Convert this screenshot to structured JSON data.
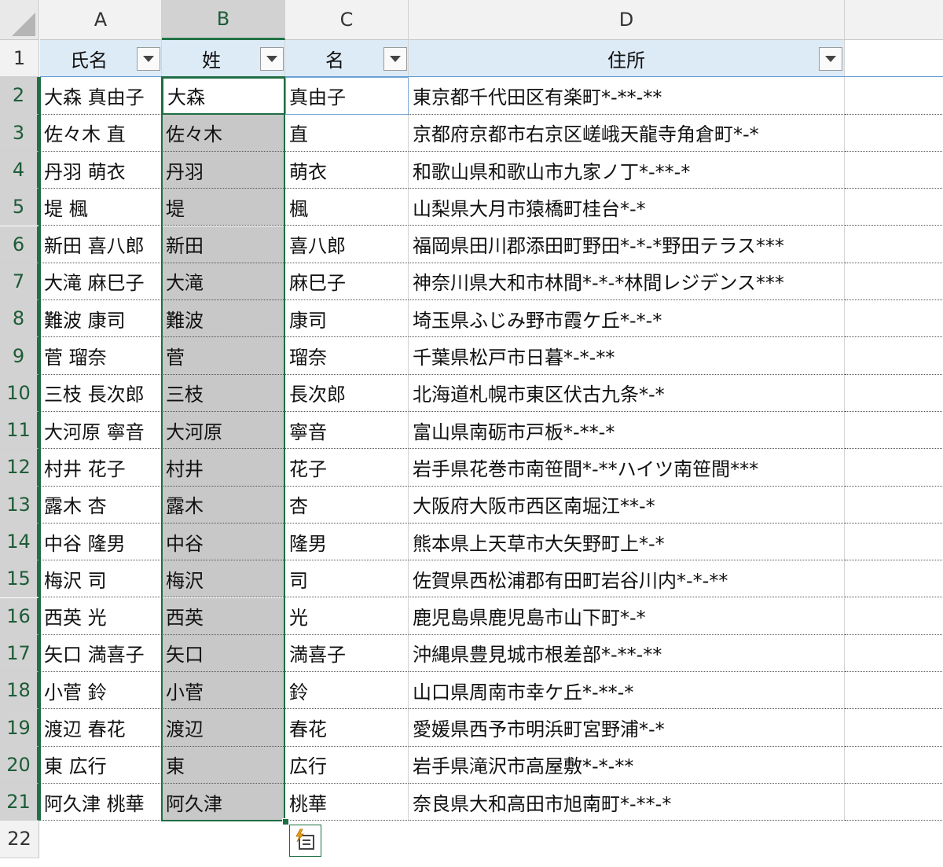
{
  "columns": [
    {
      "letter": "A",
      "selected": false
    },
    {
      "letter": "B",
      "selected": true
    },
    {
      "letter": "C",
      "selected": false
    },
    {
      "letter": "D",
      "selected": false
    }
  ],
  "header_row": {
    "row": "1",
    "cells": [
      "氏名",
      "姓",
      "名",
      "住所"
    ]
  },
  "rows": [
    {
      "row": "2",
      "cells": [
        "大森 真由子",
        "大森",
        "真由子",
        "東京都千代田区有楽町*-**-**"
      ]
    },
    {
      "row": "3",
      "cells": [
        "佐々木 直",
        "佐々木",
        "直",
        "京都府京都市右京区嵯峨天龍寺角倉町*-*"
      ]
    },
    {
      "row": "4",
      "cells": [
        "丹羽 萌衣",
        "丹羽",
        "萌衣",
        "和歌山県和歌山市九家ノ丁*-**-*"
      ]
    },
    {
      "row": "5",
      "cells": [
        "堤 楓",
        "堤",
        "楓",
        "山梨県大月市猿橋町桂台*-*"
      ]
    },
    {
      "row": "6",
      "cells": [
        "新田 喜八郎",
        "新田",
        "喜八郎",
        "福岡県田川郡添田町野田*-*-*野田テラス***"
      ]
    },
    {
      "row": "7",
      "cells": [
        "大滝 麻巳子",
        "大滝",
        "麻巳子",
        "神奈川県大和市林間*-*-*林間レジデンス***"
      ]
    },
    {
      "row": "8",
      "cells": [
        "難波 康司",
        "難波",
        "康司",
        "埼玉県ふじみ野市霞ケ丘*-*-*"
      ]
    },
    {
      "row": "9",
      "cells": [
        "菅 瑠奈",
        "菅",
        "瑠奈",
        "千葉県松戸市日暮*-*-**"
      ]
    },
    {
      "row": "10",
      "cells": [
        "三枝 長次郎",
        "三枝",
        "長次郎",
        "北海道札幌市東区伏古九条*-*"
      ]
    },
    {
      "row": "11",
      "cells": [
        "大河原 寧音",
        "大河原",
        "寧音",
        "富山県南砺市戸板*-**-*"
      ]
    },
    {
      "row": "12",
      "cells": [
        "村井 花子",
        "村井",
        "花子",
        "岩手県花巻市南笹間*-**ハイツ南笹間***"
      ]
    },
    {
      "row": "13",
      "cells": [
        "露木 杏",
        "露木",
        "杏",
        "大阪府大阪市西区南堀江**-*"
      ]
    },
    {
      "row": "14",
      "cells": [
        "中谷 隆男",
        "中谷",
        "隆男",
        "熊本県上天草市大矢野町上*-*"
      ]
    },
    {
      "row": "15",
      "cells": [
        "梅沢 司",
        "梅沢",
        "司",
        "佐賀県西松浦郡有田町岩谷川内*-*-**"
      ]
    },
    {
      "row": "16",
      "cells": [
        "西英 光",
        "西英",
        "光",
        "鹿児島県鹿児島市山下町*-*"
      ]
    },
    {
      "row": "17",
      "cells": [
        "矢口 満喜子",
        "矢口",
        "満喜子",
        "沖縄県豊見城市根差部*-**-**"
      ]
    },
    {
      "row": "18",
      "cells": [
        "小菅 鈴",
        "小菅",
        "鈴",
        "山口県周南市幸ケ丘*-**-*"
      ]
    },
    {
      "row": "19",
      "cells": [
        "渡辺 春花",
        "渡辺",
        "春花",
        "愛媛県西予市明浜町宮野浦*-*"
      ]
    },
    {
      "row": "20",
      "cells": [
        "東 広行",
        "東",
        "広行",
        "岩手県滝沢市高屋敷*-*-**"
      ]
    },
    {
      "row": "21",
      "cells": [
        "阿久津 桃華",
        "阿久津",
        "桃華",
        "奈良県大和高田市旭南町*-**-*"
      ]
    }
  ],
  "last_row": {
    "row": "22"
  },
  "icons": {
    "filter": "filter-dropdown-icon",
    "flash_fill": "flash-fill-options-icon"
  },
  "colors": {
    "accent": "#1f6e43",
    "header_fill": "#ddebf7",
    "selection_fill": "#c8c8c8"
  }
}
